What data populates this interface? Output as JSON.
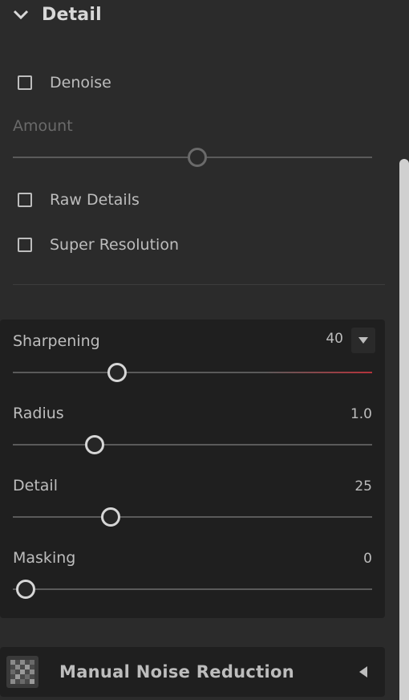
{
  "section": {
    "title": "Detail",
    "icon": "chevron-down-icon"
  },
  "checkboxes": {
    "denoise": {
      "label": "Denoise",
      "checked": false
    },
    "raw_details": {
      "label": "Raw Details",
      "checked": false
    },
    "super_resolution": {
      "label": "Super Resolution",
      "checked": false
    }
  },
  "amount": {
    "label": "Amount",
    "value_fraction": 0.5,
    "enabled": false
  },
  "sharpening": {
    "label": "Sharpening",
    "value": "40",
    "value_fraction": 0.27,
    "dropdown_icon": "triangle-down-icon",
    "accent": "#b5333b",
    "sliders": [
      {
        "label": "Radius",
        "value": "1.0",
        "value_fraction": 0.2
      },
      {
        "label": "Detail",
        "value": "25",
        "value_fraction": 0.25
      },
      {
        "label": "Masking",
        "value": "0",
        "value_fraction": 0.0
      }
    ]
  },
  "manual_noise_reduction": {
    "title": "Manual Noise Reduction",
    "icon": "noise-pattern-icon",
    "arrow_icon": "triangle-left-icon"
  },
  "colors": {
    "background": "#2b2b2b",
    "panel": "#1f1f1f",
    "text": "#bdbdbd",
    "muted": "#6a6a6a"
  }
}
